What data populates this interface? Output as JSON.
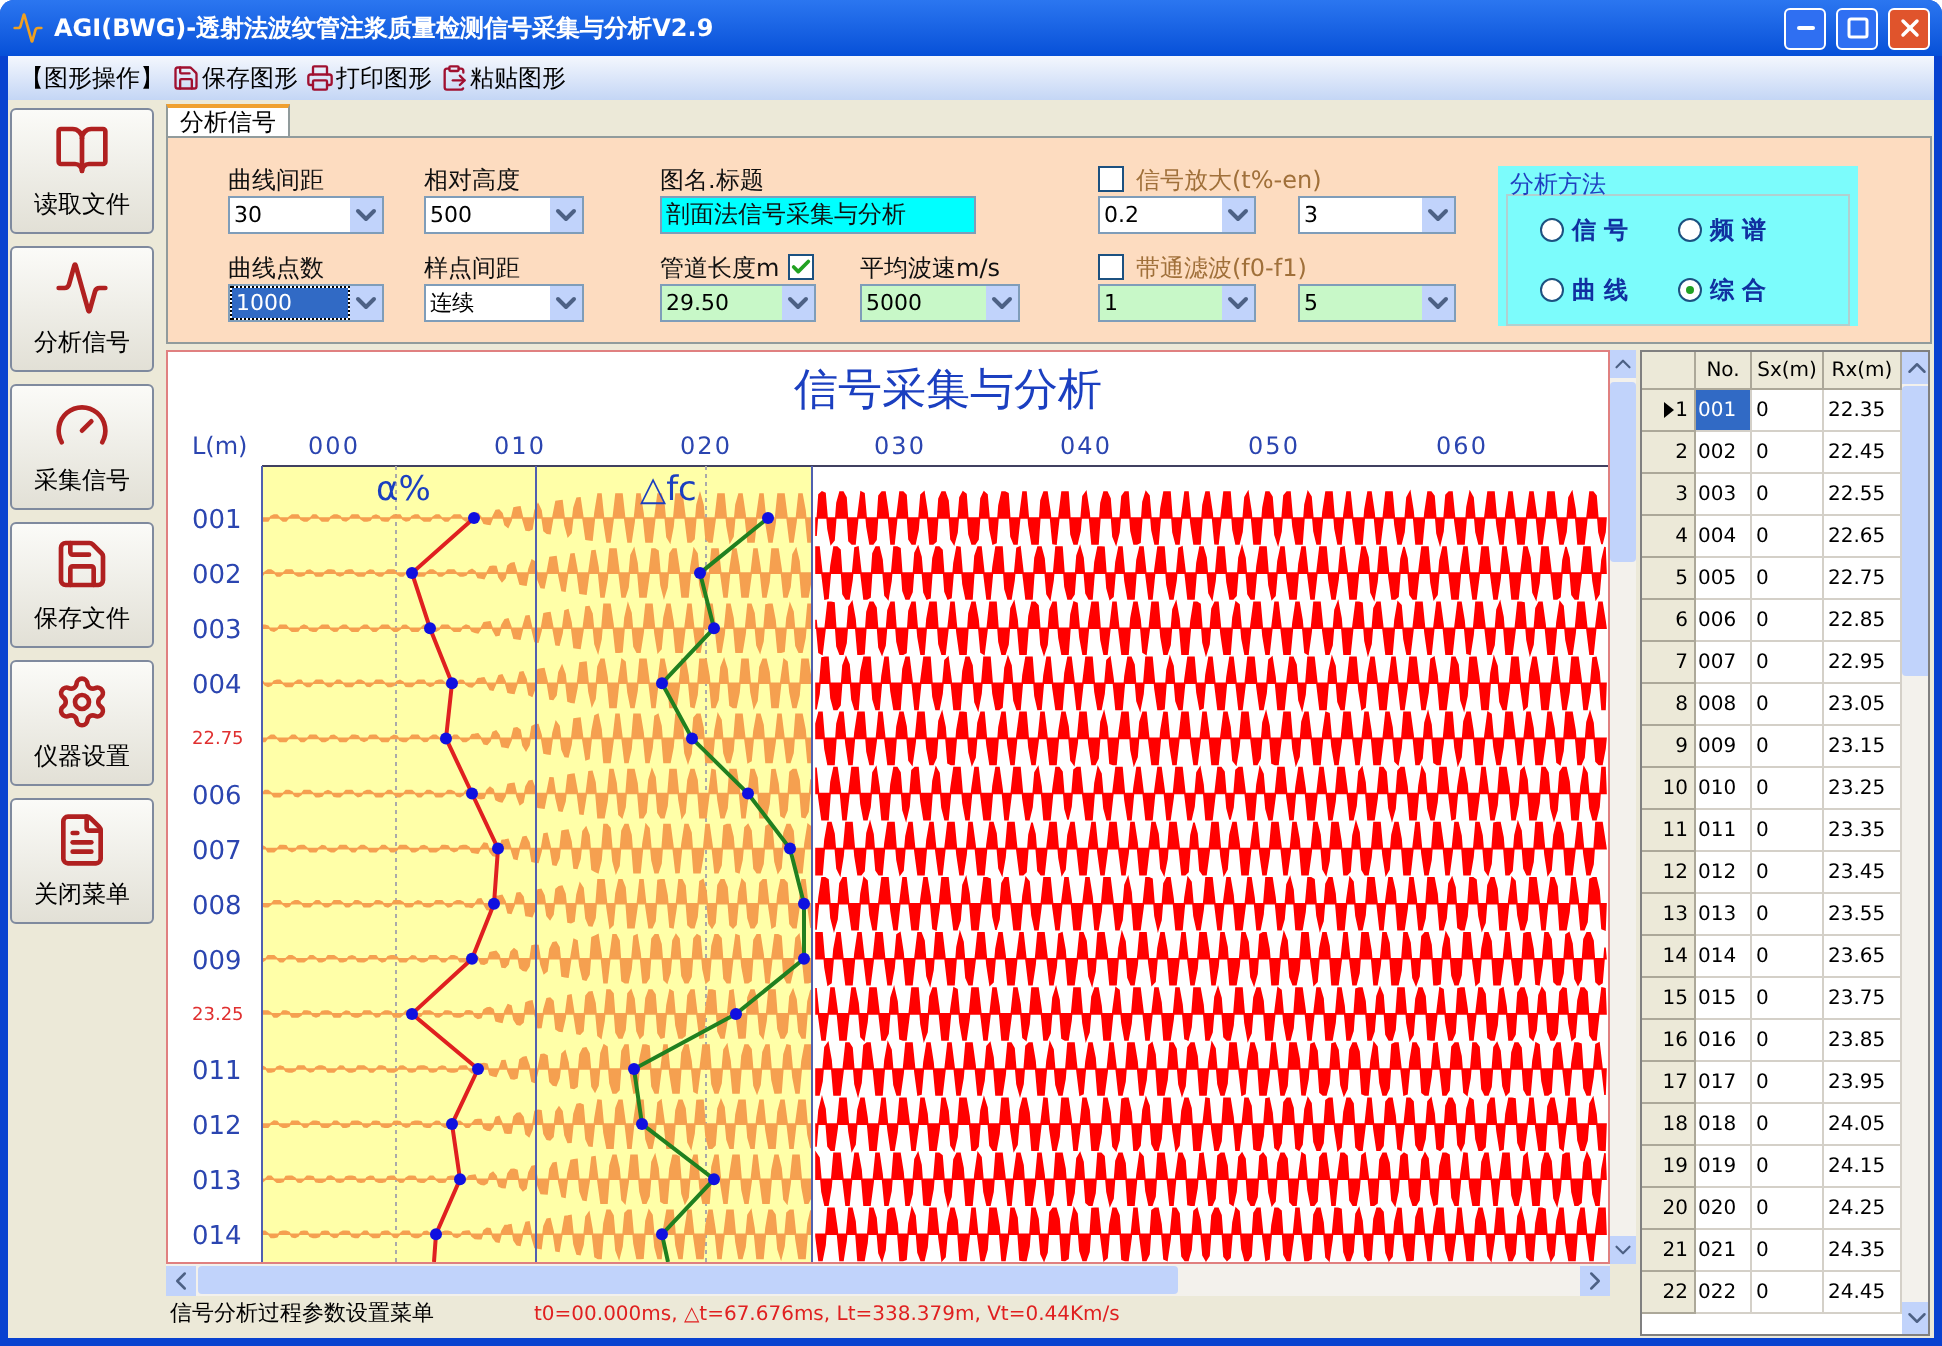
{
  "window": {
    "title": "AGI(BWG)-透射法波纹管注浆质量检测信号采集与分析V2.9"
  },
  "toolbar": {
    "group_label": "【图形操作】",
    "buttons": [
      {
        "label": "保存图形",
        "kind": "save"
      },
      {
        "label": "打印图形",
        "kind": "print"
      },
      {
        "label": "粘贴图形",
        "kind": "paste"
      }
    ]
  },
  "sidebar": {
    "items": [
      {
        "label": "读取文件",
        "kind": "book"
      },
      {
        "label": "分析信号",
        "kind": "signal"
      },
      {
        "label": "采集信号",
        "kind": "gauge"
      },
      {
        "label": "保存文件",
        "kind": "save"
      },
      {
        "label": "仪器设置",
        "kind": "settings"
      },
      {
        "label": "关闭菜单",
        "kind": "close"
      }
    ]
  },
  "tabs": [
    {
      "label": "分析信号",
      "selected": true
    }
  ],
  "params": {
    "curve_spacing": {
      "label": "曲线间距",
      "value": "30"
    },
    "relative_height": {
      "label": "相对高度",
      "value": "500"
    },
    "figure_title": {
      "label": "图名.标题",
      "value": "剖面法信号采集与分析"
    },
    "signal_gain": {
      "label": "信号放大(t%-en)",
      "checked": false,
      "values": [
        "0.2",
        "3"
      ]
    },
    "curve_points": {
      "label": "曲线点数",
      "value": "1000",
      "focused": true
    },
    "sample_spacing": {
      "label": "样点间距",
      "value": "连续"
    },
    "pipe_length": {
      "label": "管道长度m",
      "checked": true,
      "value": "29.50"
    },
    "wave_speed": {
      "label": "平均波速m/s",
      "value": "5000"
    },
    "bandpass": {
      "label": "带通滤波(f0-f1)",
      "checked": false,
      "values": [
        "1",
        "5"
      ]
    }
  },
  "analysis_method": {
    "title": "分析方法",
    "options": [
      {
        "label": "信 号",
        "selected": false
      },
      {
        "label": "频 谱",
        "selected": false
      },
      {
        "label": "曲 线",
        "selected": false
      },
      {
        "label": "综 合",
        "selected": true
      }
    ]
  },
  "chart": {
    "title": "信号采集与分析",
    "axis_label": "L(m)",
    "ticks": [
      "000",
      "010",
      "020",
      "030",
      "040",
      "050",
      "060"
    ],
    "panel_labels": [
      "α%",
      "△fc"
    ],
    "rows": [
      {
        "label": "001",
        "flagged": false
      },
      {
        "label": "002",
        "flagged": false
      },
      {
        "label": "003",
        "flagged": false
      },
      {
        "label": "004",
        "flagged": false
      },
      {
        "label": "22.75",
        "flagged": true
      },
      {
        "label": "006",
        "flagged": false
      },
      {
        "label": "007",
        "flagged": false
      },
      {
        "label": "008",
        "flagged": false
      },
      {
        "label": "009",
        "flagged": false
      },
      {
        "label": "23.25",
        "flagged": true
      },
      {
        "label": "011",
        "flagged": false
      },
      {
        "label": "012",
        "flagged": false
      },
      {
        "label": "013",
        "flagged": false
      },
      {
        "label": "014",
        "flagged": false
      }
    ]
  },
  "table": {
    "columns": [
      "No.",
      "Sx(m)",
      "Rx(m)"
    ],
    "rows": [
      {
        "index": "1",
        "no": "001",
        "sx": "0",
        "rx": "22.35",
        "selected": true
      },
      {
        "index": "2",
        "no": "002",
        "sx": "0",
        "rx": "22.45",
        "selected": false
      },
      {
        "index": "3",
        "no": "003",
        "sx": "0",
        "rx": "22.55",
        "selected": false
      },
      {
        "index": "4",
        "no": "004",
        "sx": "0",
        "rx": "22.65",
        "selected": false
      },
      {
        "index": "5",
        "no": "005",
        "sx": "0",
        "rx": "22.75",
        "selected": false
      },
      {
        "index": "6",
        "no": "006",
        "sx": "0",
        "rx": "22.85",
        "selected": false
      },
      {
        "index": "7",
        "no": "007",
        "sx": "0",
        "rx": "22.95",
        "selected": false
      },
      {
        "index": "8",
        "no": "008",
        "sx": "0",
        "rx": "23.05",
        "selected": false
      },
      {
        "index": "9",
        "no": "009",
        "sx": "0",
        "rx": "23.15",
        "selected": false
      },
      {
        "index": "10",
        "no": "010",
        "sx": "0",
        "rx": "23.25",
        "selected": false
      },
      {
        "index": "11",
        "no": "011",
        "sx": "0",
        "rx": "23.35",
        "selected": false
      },
      {
        "index": "12",
        "no": "012",
        "sx": "0",
        "rx": "23.45",
        "selected": false
      },
      {
        "index": "13",
        "no": "013",
        "sx": "0",
        "rx": "23.55",
        "selected": false
      },
      {
        "index": "14",
        "no": "014",
        "sx": "0",
        "rx": "23.65",
        "selected": false
      },
      {
        "index": "15",
        "no": "015",
        "sx": "0",
        "rx": "23.75",
        "selected": false
      },
      {
        "index": "16",
        "no": "016",
        "sx": "0",
        "rx": "23.85",
        "selected": false
      },
      {
        "index": "17",
        "no": "017",
        "sx": "0",
        "rx": "23.95",
        "selected": false
      },
      {
        "index": "18",
        "no": "018",
        "sx": "0",
        "rx": "24.05",
        "selected": false
      },
      {
        "index": "19",
        "no": "019",
        "sx": "0",
        "rx": "24.15",
        "selected": false
      },
      {
        "index": "20",
        "no": "020",
        "sx": "0",
        "rx": "24.25",
        "selected": false
      },
      {
        "index": "21",
        "no": "021",
        "sx": "0",
        "rx": "24.35",
        "selected": false
      },
      {
        "index": "22",
        "no": "022",
        "sx": "0",
        "rx": "24.45",
        "selected": false
      }
    ]
  },
  "status_bar": {
    "message": "信号分析过程参数设置菜单",
    "readout": "t0=00.000ms, △t=67.676ms, Lt=338.379m, Vt=0.44Km/s"
  }
}
